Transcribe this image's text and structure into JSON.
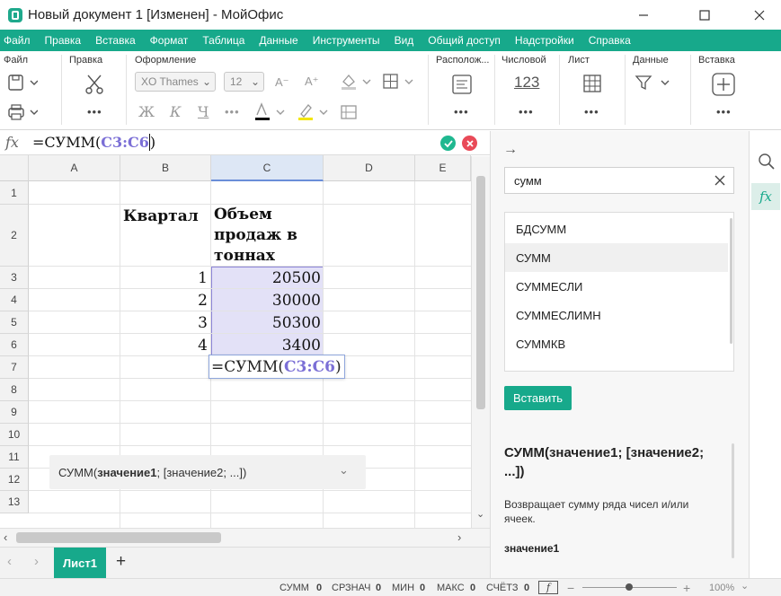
{
  "window": {
    "title": "Новый документ 1 [Изменен] - МойОфис"
  },
  "menu": [
    "Файл",
    "Правка",
    "Вставка",
    "Формат",
    "Таблица",
    "Данные",
    "Инструменты",
    "Вид",
    "Общий доступ",
    "Надстройки",
    "Справка"
  ],
  "ribbon": {
    "groups": {
      "file": "Файл",
      "edit": "Правка",
      "format": "Оформление",
      "arrange": "Располож...",
      "number": "Числовой",
      "sheet": "Лист",
      "data": "Данные",
      "insert": "Вставка"
    },
    "font_name": "XO Thames",
    "font_size": "12",
    "number_sample": "123",
    "bold": "Ж",
    "italic": "К",
    "underline": "Ч",
    "dec_font": "A⁻",
    "inc_font": "A⁺"
  },
  "formula_bar": {
    "fx": "fx",
    "prefix": "=СУММ(",
    "range": "C3:C6",
    "suffix": ")"
  },
  "columns": [
    "A",
    "B",
    "C",
    "D",
    "E"
  ],
  "rows": [
    "1",
    "2",
    "3",
    "4",
    "5",
    "6",
    "7",
    "8",
    "9",
    "10",
    "11",
    "12",
    "13"
  ],
  "cells": {
    "b2": "Квартал",
    "c2": "Объем продаж в тоннах",
    "b3": "1",
    "b4": "2",
    "b5": "3",
    "b6": "4",
    "c3": "20500",
    "c4": "30000",
    "c5": "50300",
    "c6": "3400"
  },
  "edit_cell": {
    "prefix": "=СУММ(",
    "range": "C3:C6",
    "suffix": ")"
  },
  "hint": {
    "fn": "СУММ(",
    "arg1": "значение1",
    "rest": "; [значение2; ...])"
  },
  "sheet_tabs": {
    "active": "Лист1",
    "add": "+"
  },
  "sidebar": {
    "search_value": "сумм",
    "functions": [
      "БДСУММ",
      "СУММ",
      "СУММЕСЛИ",
      "СУММЕСЛИМН",
      "СУММКВ"
    ],
    "selected_index": 1,
    "insert_label": "Вставить",
    "signature": "СУММ(значение1; [значение2; ...])",
    "description": "Возвращает сумму ряда чисел и/или ячеек.",
    "param": "значение1"
  },
  "status": {
    "items": [
      {
        "label": "СУММ",
        "value": "0"
      },
      {
        "label": "СРЗНАЧ",
        "value": "0"
      },
      {
        "label": "МИН",
        "value": "0"
      },
      {
        "label": "МАКС",
        "value": "0"
      },
      {
        "label": "СЧЁТЗ",
        "value": "0"
      }
    ],
    "zoom": "100%"
  },
  "colors": {
    "accent": "#17a98b",
    "selection": "#e3e1f7",
    "range_text": "#7b6fd6"
  }
}
